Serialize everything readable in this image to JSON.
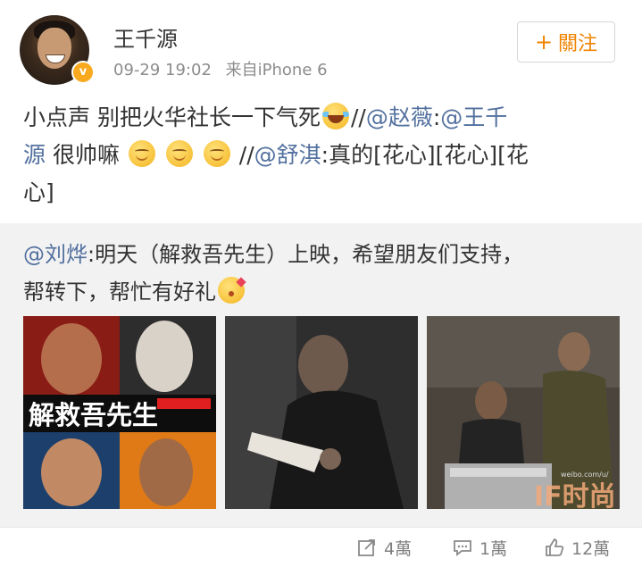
{
  "post": {
    "username": "王千源",
    "date": "09-29 19:02",
    "source": "来自iPhone 6",
    "follow_label": "關注",
    "follow_icon": "plus-icon",
    "verified_badge_color": "#f8a91e",
    "content": {
      "t1": "小点声 别把火华社长一下气死",
      "t2": "//",
      "m1": "@赵薇",
      "t3": ":",
      "m2a": "@王千",
      "m2b": "源",
      "t4": " 很帅嘛",
      "t5": " //",
      "m3": "@舒淇",
      "t6": ":真的[花心][花心][花",
      "t7": "心]"
    }
  },
  "repost": {
    "mention": "@刘烨",
    "line1": ":明天（解救吾先生）上映，希望朋友们支持，",
    "line2": "帮转下，帮忙有好礼",
    "poster_title": "解救吾先生",
    "watermark": "IF时尚",
    "watermark_url": "weibo.com/u/"
  },
  "actions": {
    "repost_count": "4萬",
    "comment_count": "1萬",
    "like_count": "12萬"
  },
  "colors": {
    "link": "#53719f",
    "follow_orange": "#f08300",
    "repost_bg": "#f2f2f2",
    "meta_gray": "#8c8c8c"
  }
}
